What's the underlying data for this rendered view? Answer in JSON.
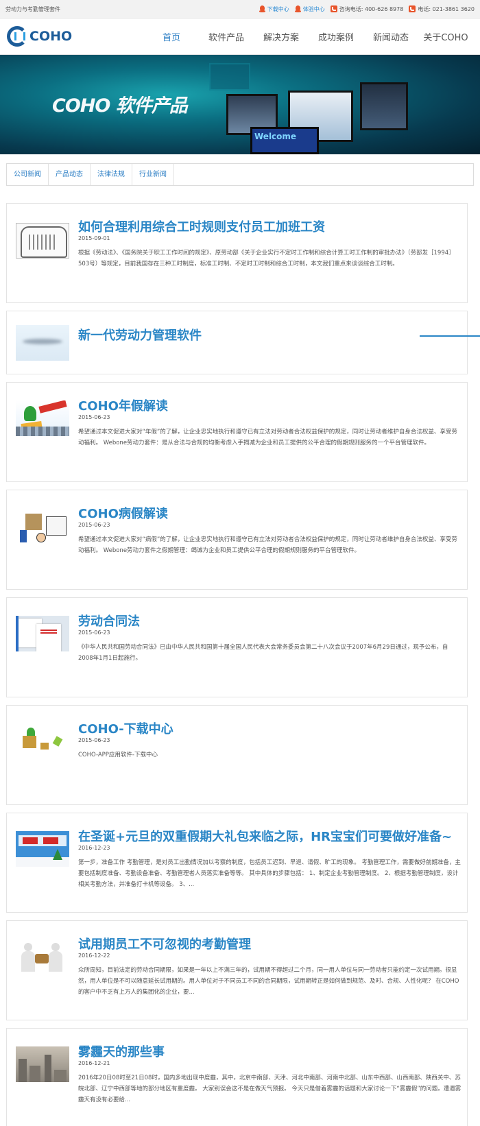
{
  "topbar": {
    "slogan": "劳动力与考勤管理套件",
    "download_center": "下载中心",
    "trial_center": "体验中心",
    "consult_phone": "咨询电话: 400-626 8978",
    "phone": "电话: 021-3861 3620"
  },
  "logo": {
    "text": "COHO"
  },
  "nav": {
    "items": [
      "首页",
      "软件产品",
      "解决方案",
      "成功案例",
      "新闻动态",
      "关于COHO"
    ],
    "active_index": 0
  },
  "banner": {
    "title": "COHO 软件产品",
    "screen_text": "Welcome"
  },
  "tabs": [
    "公司新闻",
    "产品动态",
    "法律法规",
    "行业新闻"
  ],
  "articles": [
    {
      "title": "如何合理利用综合工时规则支付员工加班工资",
      "date": "2015-09-01",
      "summary": "根据《劳动法》、《国务院关于职工工作时间的规定》、原劳动部《关于企业实行不定时工作制和综合计算工时工作制的审批办法》（劳部发［1994］503号）等规定，目前我国存在三种工时制度，标准工时制、不定时工时制和综合工时制，本文我们重点来谈谈综合工时制。",
      "thumb": "sketch-document-thumb"
    },
    {
      "title": "新一代劳动力管理软件",
      "date": "",
      "summary": "",
      "thumb": "blurred-thumb"
    },
    {
      "title": "COHO年假解读",
      "date": "2015-06-23",
      "summary": "希望通过本文促进大家对“年假”的了解，让企业忠实地执行和遵守已有立法对劳动者合法权益保护的规定，同时让劳动者维护自身合法权益、享受劳动福利。 Webone劳动力套件：是从合法与合规的均衡考虑入手揭减为企业和员工提供的公平合理的假期规则服务的一个平台管理软件。",
      "thumb": "kite-cartoon-thumb"
    },
    {
      "title": "COHO病假解读",
      "date": "2015-06-23",
      "summary": "希望通过本文促进大家对“病假”的了解，让企业忠实地执行和遵守已有立法对劳动者合法权益保护的规定，同时让劳动者维护自身合法权益、享受劳动福利。 Webone劳动力套件之假期管理：竭诚为企业和员工提供公平合理的假期规则服务的平台管理软件。",
      "thumb": "sick-cartoon-thumb"
    },
    {
      "title": "劳动合同法",
      "date": "2015-06-23",
      "summary": "《中华人民共和国劳动合同法》已由中华人民共和国第十届全国人民代表大会常务委员会第二十八次会议于2007年6月29日通过，现予公布，自2008年1月1日起施行。",
      "thumb": "contract-document-thumb"
    },
    {
      "title": "COHO-下载中心",
      "date": "2015-06-23",
      "summary": "COHO-APP应用软件-下载中心",
      "thumb": "download-boxes-thumb"
    },
    {
      "title": "在圣诞+元旦的双重假期大礼包来临之际，HR宝宝们可要做好准备~",
      "date": "2016-12-23",
      "summary": "第一步，准备工作 考勤管理，是对员工出勤情况加以考察的制度，包括员工迟到、早退、请假、旷工的现象。 考勤管理工作，需要做好前期准备，主要包括制度准备、考勤设备准备、考勤管理者人员落实准备等等。 其中具体的步骤包括： 1、制定企业考勤管理制度。 2、根据考勤管理制度，设计相关考勤方法，并准备打卡机等设备。 3、...",
      "thumb": "christmas-thumb"
    },
    {
      "title": "试用期员工不可忽视的考勤管理",
      "date": "2016-12-22",
      "summary": "众所周知，目前法定的劳动合同期限，如果是一年以上不满三年的，试用期不得超过二个月，同一用人单位与同一劳动者只能约定一次试用期。很显然，用人单位是不可以随意延长试用期的。用人单位对于不同员工不同的合同期限，试用期转正是如何做到规范、及时、合规、人性化呢？ 在COHO的客户中不乏有上万人的集团化的企业，要...",
      "thumb": "handshake-thumb"
    },
    {
      "title": "雾霾天的那些事",
      "date": "2016-12-21",
      "summary": "2016年20日08时至21日08时，国内多地出现中度霾，其中，北京中南部、天津、河北中南部、河南中北部、山东中西部、山西南部、陕西关中、苏皖北部、辽宁中西部等地的部分地区有重度霾。 大家别误会这不是在做天气预报。 今天只是借着雾霾的话题和大家讨论一下“雾霾假”的问题。遭遇雾霾天有没有必要给...",
      "thumb": "smog-city-thumb"
    }
  ]
}
